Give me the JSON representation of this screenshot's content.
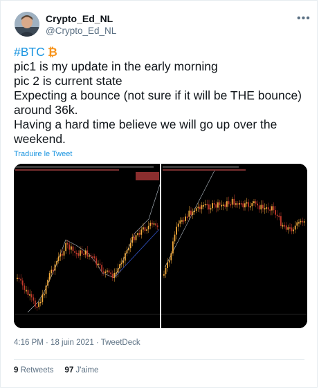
{
  "tweet": {
    "display_name": "Crypto_Ed_NL",
    "handle": "@Crypto_Ed_NL",
    "more_icon": "•••",
    "hashtag": "#BTC",
    "lines": [
      "pic1 is my update in the early morning",
      "pic 2 is current state",
      "Expecting a bounce (not sure if it will be THE bounce)",
      "around 36k.",
      "Having a hard time believe we will go up over the",
      "weekend."
    ],
    "translate_label": "Traduire le Tweet",
    "timestamp": "4:16 PM · 18 juin 2021 · TweetDeck",
    "retweets_count": "9",
    "retweets_label": "Retweets",
    "likes_count": "97",
    "likes_label": "J'aime"
  },
  "colors": {
    "link": "#1b95e0",
    "secondary": "#5b7083",
    "bitcoin": "#f7931a",
    "chart_bg": "#000000",
    "candle_up": "#f2a93b",
    "candle_down": "#c0392b"
  },
  "icons": [
    "bitcoin-icon",
    "more-icon"
  ]
}
